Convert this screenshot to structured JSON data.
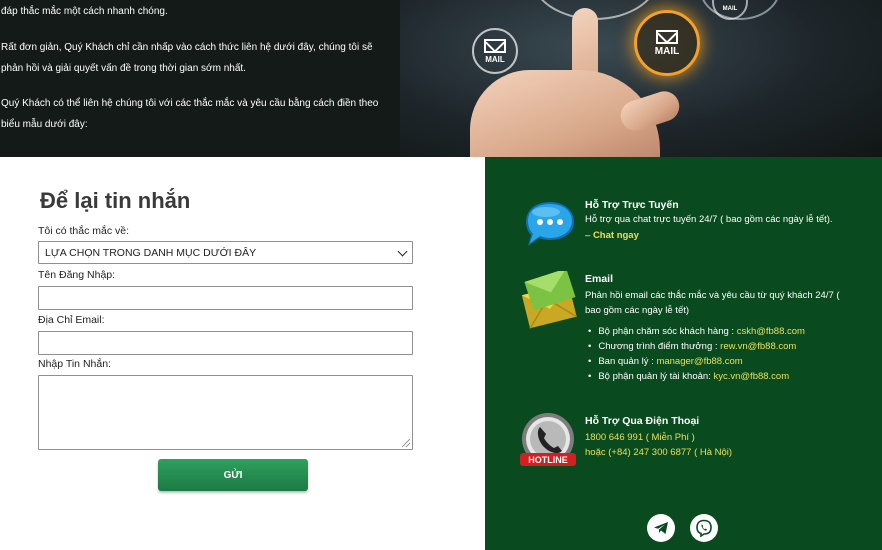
{
  "hero": {
    "line1": "đáp thắc mắc một cách nhanh chóng.",
    "line2": "Rất đơn giản, Quý Khách chỉ cần nhấp vào cách thức liên hệ dưới đây, chúng tôi sẽ",
    "line3": "phản hồi và giải quyết vấn đề trong thời gian sớm nhất.",
    "line4": "Quý Khách có thể liên hệ chúng tôi với các thắc mắc và yêu cầu bằng cách điền theo",
    "line5": "biểu mẫu dưới đây:",
    "mail_badge_left": "MAIL",
    "mail_badge_right": "MAIL",
    "mail_badge_top": "MAIL"
  },
  "form": {
    "title": "Để lại tin nhắn",
    "question_label": "Tôi có thắc mắc về:",
    "question_select_value": "LỰA CHỌN TRONG DANH MỤC DƯỚI ĐÂY",
    "username_label": "Tên Đăng Nhập:",
    "username_value": "",
    "email_label": "Địa Chỉ Email:",
    "email_value": "",
    "message_label": "Nhập Tin Nhắn:",
    "message_value": "",
    "submit_label": "GỬI"
  },
  "support": {
    "chat_title": "Hỗ Trợ Trực Tuyến",
    "chat_text": "Hỗ trợ qua chat trực tuyến 24/7 ( bao gồm các ngày lễ tết).",
    "chat_link_prefix": "– ",
    "chat_link": "Chat ngay",
    "email_title": "Email",
    "email_text_1": "Phản hồi email các thắc mắc và yêu cầu từ quý khách 24/7 (",
    "email_text_2": "bao gồm các ngày lễ tết)",
    "contacts": [
      {
        "label": "Bộ phận chăm sóc khách hàng : ",
        "email": "cskh@fb88.com"
      },
      {
        "label": "Chương trình điểm thưởng : ",
        "email": "rew.vn@fb88.com"
      },
      {
        "label": "Ban quản lý : ",
        "email": "manager@fb88.com"
      },
      {
        "label": "Bộ phận quản lý tài khoản: ",
        "email": "kyc.vn@fb88.com"
      }
    ],
    "phone_title": "Hỗ Trợ Qua Điện Thoại",
    "phone_free": "1800 646 991 ( Miễn Phí )",
    "phone_hanoi": "hoặc (+84) 247 300 6877 ( Hà Nội)",
    "hotline_badge": "HOTLINE"
  },
  "colors": {
    "support_bg": "#0a4a1f",
    "accent_yellow": "#e8e05a",
    "button_green": "#1b7a44"
  },
  "icons": [
    "chat-bubble-icon",
    "envelope-icon",
    "hotline-phone-icon",
    "telegram-icon",
    "viber-icon"
  ]
}
